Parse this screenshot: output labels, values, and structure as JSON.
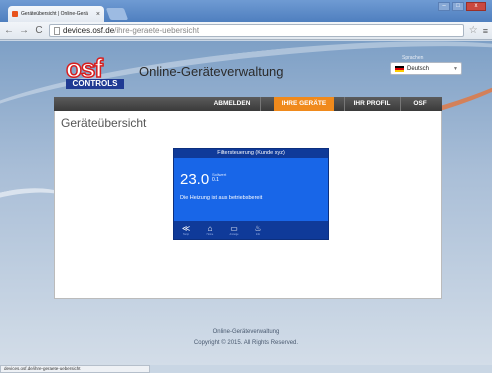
{
  "browser": {
    "tab_title": "Geräteübersicht | Online-Gerä",
    "tab_close": "×",
    "url_host": "devices.osf.de",
    "url_path": "/ihre-geraete-uebersicht",
    "status_url": "devices.osf.de/ihre-geraete-uebersicht",
    "back": "←",
    "forward": "→",
    "reload": "C",
    "bookmark": "☆",
    "menu": "≡"
  },
  "header": {
    "logo_letters": "osf",
    "logo_sub": "CONTROLS",
    "site_title": "Online-Geräteverwaltung",
    "language_label": "Sprachen",
    "language_value": "Deutsch"
  },
  "nav": {
    "items": [
      {
        "label": "ABMELDEN",
        "active": false
      },
      {
        "label": "IHRE GERÄTE",
        "active": true
      },
      {
        "label": "IHR PROFIL",
        "active": false
      },
      {
        "label": "OSF",
        "active": false
      }
    ]
  },
  "main": {
    "title": "Geräteübersicht",
    "device": {
      "name": "Filtersteuerung (Kunde xyz)",
      "temperature": "23.0",
      "setpoint_label": "Sollwert",
      "setpoint_value": "0.1",
      "status_text": "Die Heizung ist aus betriebsbereit",
      "footer_icons": [
        {
          "icon": "temperature-icon",
          "label": "Temp"
        },
        {
          "icon": "home-icon",
          "label": "Home"
        },
        {
          "icon": "monitor-icon",
          "label": "Anzeige"
        },
        {
          "icon": "thermometer-icon",
          "label": "Info"
        }
      ]
    }
  },
  "footer": {
    "line1": "Online-Geräteverwaltung",
    "line2": "Copyright © 2015. All Rights Reserved."
  },
  "colors": {
    "accent": "#f08a1c",
    "device_panel": "#1866e8",
    "device_header": "#0f3a99",
    "logo_red": "#d81d1d",
    "logo_blue": "#1f3a93"
  }
}
